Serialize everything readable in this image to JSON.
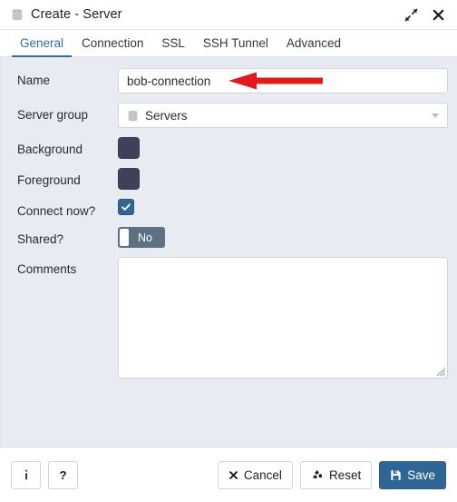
{
  "window": {
    "title": "Create - Server",
    "title_icon": "server-stack-icon",
    "expand_icon": "expand-diagonal-icon",
    "close_icon": "close-x-icon"
  },
  "tabs": [
    {
      "label": "General",
      "active": true
    },
    {
      "label": "Connection",
      "active": false
    },
    {
      "label": "SSL",
      "active": false
    },
    {
      "label": "SSH Tunnel",
      "active": false
    },
    {
      "label": "Advanced",
      "active": false
    }
  ],
  "form": {
    "name": {
      "label": "Name",
      "value": "bob-connection",
      "placeholder": ""
    },
    "server_group": {
      "label": "Server group",
      "value": "Servers",
      "icon": "server-stack-icon",
      "caret_icon": "chevron-down-icon"
    },
    "background": {
      "label": "Background",
      "color": "#3f4059"
    },
    "foreground": {
      "label": "Foreground",
      "color": "#3f4059"
    },
    "connect_now": {
      "label": "Connect now?",
      "checked": true,
      "color": "#326690"
    },
    "shared": {
      "label": "Shared?",
      "state_label": "No",
      "on": false,
      "color": "#5e7184"
    },
    "comments": {
      "label": "Comments",
      "value": "",
      "placeholder": ""
    }
  },
  "footer": {
    "info_label": "i",
    "help_label": "?",
    "cancel_label": "Cancel",
    "reset_label": "Reset",
    "save_label": "Save",
    "cancel_icon": "close-x-icon",
    "reset_icon": "recycle-icon",
    "save_icon": "floppy-disk-icon",
    "save_color": "#2f6695"
  },
  "annotation": {
    "arrow_color": "#e01b1b",
    "arrow_direction": "left",
    "points_at": "name-input"
  }
}
